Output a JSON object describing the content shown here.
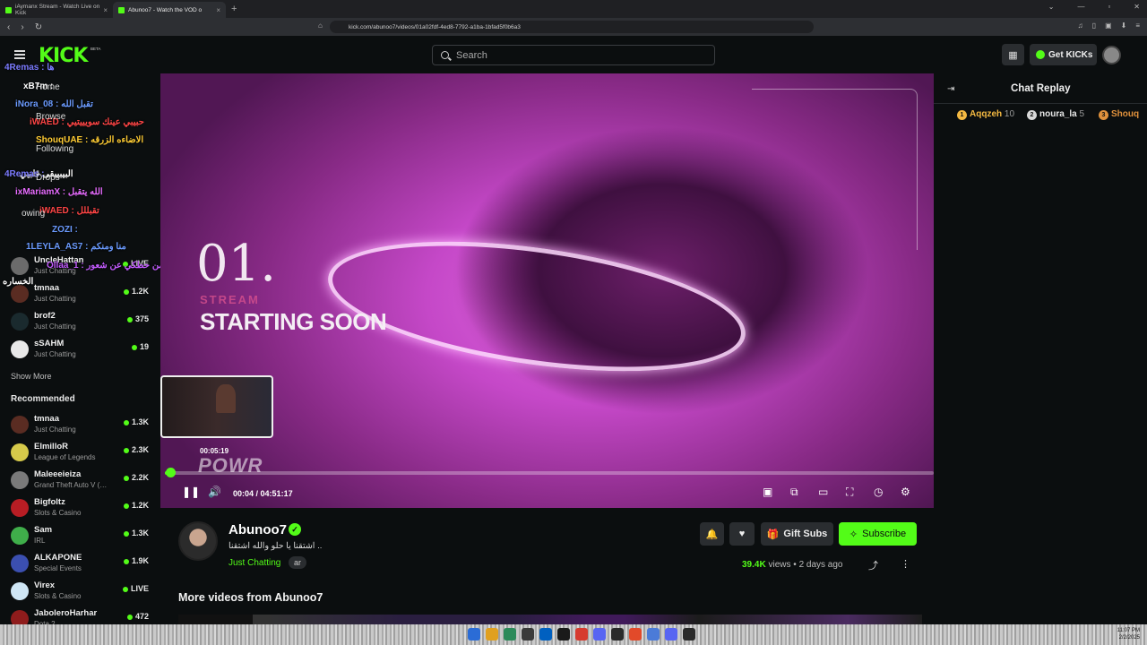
{
  "browser": {
    "tabs": [
      {
        "title": "iAymanx Stream - Watch Live on Kick"
      },
      {
        "title": "Abunoo7 - Watch the VOD o"
      }
    ],
    "url": "kick.com/abunoo7/videos/01a02fdf-4ed8-7792-a1ba-1bfad5f0b6a3"
  },
  "header": {
    "logo": "KICK",
    "beta": "BETA",
    "search_placeholder": "Search",
    "get_kicks": "Get KICKs"
  },
  "sidebar": {
    "following": [
      {
        "name": "UncleHattan",
        "category": "Just Chatting",
        "viewers": "LIVE",
        "color": "#6b6b6b"
      },
      {
        "name": "tmnaa",
        "category": "Just Chatting",
        "viewers": "1.2K",
        "color": "#5a2c22"
      },
      {
        "name": "brof2",
        "category": "Just Chatting",
        "viewers": "375",
        "color": "#1a2a2e"
      },
      {
        "name": "sSAHM",
        "category": "Just Chatting",
        "viewers": "19",
        "color": "#e8e8e8"
      }
    ],
    "show_more": "Show More",
    "recommended_title": "Recommended",
    "recommended": [
      {
        "name": "tmnaa",
        "category": "Just Chatting",
        "viewers": "1.3K",
        "color": "#5a2c22"
      },
      {
        "name": "ElmilloR",
        "category": "League of Legends",
        "viewers": "2.3K",
        "color": "#d6c94a"
      },
      {
        "name": "Maleeeieiza",
        "category": "Grand Theft Auto V (…",
        "viewers": "2.2K",
        "color": "#7a7a7a"
      },
      {
        "name": "Bigfoltz",
        "category": "Slots & Casino",
        "viewers": "1.2K",
        "color": "#b81d24"
      },
      {
        "name": "Sam",
        "category": "IRL",
        "viewers": "1.3K",
        "color": "#3fae4a"
      },
      {
        "name": "ALKAPONE",
        "category": "Special Events",
        "viewers": "1.9K",
        "color": "#3b4fb0"
      },
      {
        "name": "Virex",
        "category": "Slots & Casino",
        "viewers": "LIVE",
        "color": "#cfe6f5"
      },
      {
        "name": "JaboleroHarhar",
        "category": "Dota 2",
        "viewers": "472",
        "color": "#8e1c1c"
      }
    ]
  },
  "overlay": [
    {
      "text": "4Remas : ها",
      "color": "#7b7bff"
    },
    {
      "text": "xB7m :",
      "color": "#ffffff"
    },
    {
      "text": "iNora_08 : تقبل الله",
      "color": "#6b9bff"
    },
    {
      "text": "iWAED : حبيبي عينك سويييتيي",
      "color": "#ff4545"
    },
    {
      "text": "ShouqUAE : الاضاءه الزرقه",
      "color": "#ffcc33"
    },
    {
      "text": "البيبيبقى قلبيي",
      "color": "#ffffff"
    },
    {
      "text": "4Remas :",
      "color": "#7b7bff"
    },
    {
      "text": "ixMariamX : الله يتقبل",
      "color": "#e76cff"
    },
    {
      "text": "iWAED : تقبللل",
      "color": "#ff4545"
    },
    {
      "text": "ZOZI :",
      "color": "#6b9bff"
    },
    {
      "text": "1LEYLA_AS7 : منا ومنكم",
      "color": "#6b9bff"
    },
    {
      "text": "Ollaa_1 : ايمن حطكي عن شعور",
      "color": "#c35cff"
    },
    {
      "text": "الخساره",
      "color": "#ffffff"
    }
  ],
  "overlay_ghosts": [
    "Home",
    "Browse",
    "Following",
    "Drops",
    "owing"
  ],
  "video": {
    "number": "01.",
    "sub": "STREAM",
    "title": "STARTING SOON",
    "preview_time": "00:05:19",
    "watermark": "POWR",
    "current_time": "00:04",
    "duration": "04:51:17",
    "progress": 0.0002
  },
  "channel": {
    "name": "Abunoo7",
    "title": "اشتقنا يا حلو والله اشتقنا ..",
    "category": "Just Chatting",
    "tag": "ar",
    "gift_subs": "Gift Subs",
    "subscribe": "Subscribe",
    "views": "39.4K",
    "views_label": "views",
    "age": "2 days ago"
  },
  "more_videos_title": "More videos from Abunoo7",
  "chat": {
    "title": "Chat Replay",
    "gifters": [
      {
        "name": "Aqqzeh",
        "count": "10",
        "rank": "1",
        "color": "#f4b942"
      },
      {
        "name": "noura_la",
        "count": "5",
        "rank": "2",
        "color": "#d8d8d8"
      },
      {
        "name": "Shouq",
        "count": "",
        "rank": "3",
        "color": "#e0913c"
      }
    ]
  },
  "taskbar": {
    "time": "11:07 PM",
    "date": "2/2/2025"
  }
}
